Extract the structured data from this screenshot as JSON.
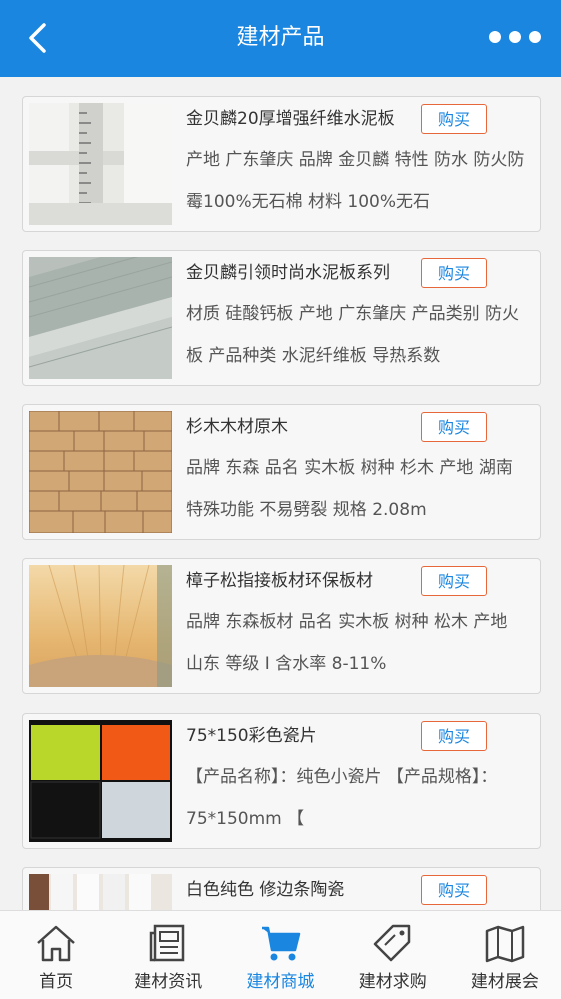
{
  "header": {
    "title": "建材产品",
    "back_icon": "chevron-left-icon",
    "more_icon": "more-dots-icon"
  },
  "products": [
    {
      "name": "金贝麟20厚增强纤维水泥板",
      "buy": "购买",
      "desc": "产地 广东肇庆 品牌 金贝麟 特性 防水 防火防霉100%无石棉 材料 100%无石"
    },
    {
      "name": "金贝麟引领时尚水泥板系列",
      "buy": "购买",
      "desc": "材质 硅酸钙板 产地 广东肇庆 产品类别 防火板 产品种类 水泥纤维板 导热系数"
    },
    {
      "name": "杉木木材原木",
      "buy": "购买",
      "desc": "品牌 东森 品名 实木板 树种 杉木 产地 湖南 特殊功能 不易劈裂 规格 2.08m"
    },
    {
      "name": "樟子松指接板材环保板材",
      "buy": "购买",
      "desc": "品牌 东森板材 品名 实木板 树种 松木 产地 山东 等级 Ⅰ 含水率 8-11%"
    },
    {
      "name": "75*150彩色瓷片",
      "buy": "购买",
      "desc": "【产品名称】：纯色小瓷片 【产品规格】：75*150mm 【"
    },
    {
      "name": "白色纯色 修边条陶瓷",
      "buy": "购买",
      "desc": ""
    }
  ],
  "tabs": [
    {
      "label": "首页",
      "icon": "home-icon"
    },
    {
      "label": "建材资讯",
      "icon": "news-icon"
    },
    {
      "label": "建材商城",
      "icon": "cart-icon",
      "active": true
    },
    {
      "label": "建材求购",
      "icon": "tag-icon"
    },
    {
      "label": "建材展会",
      "icon": "map-icon"
    }
  ],
  "colors": {
    "primary": "#1a86e0",
    "buy_border": "#e8673a"
  }
}
